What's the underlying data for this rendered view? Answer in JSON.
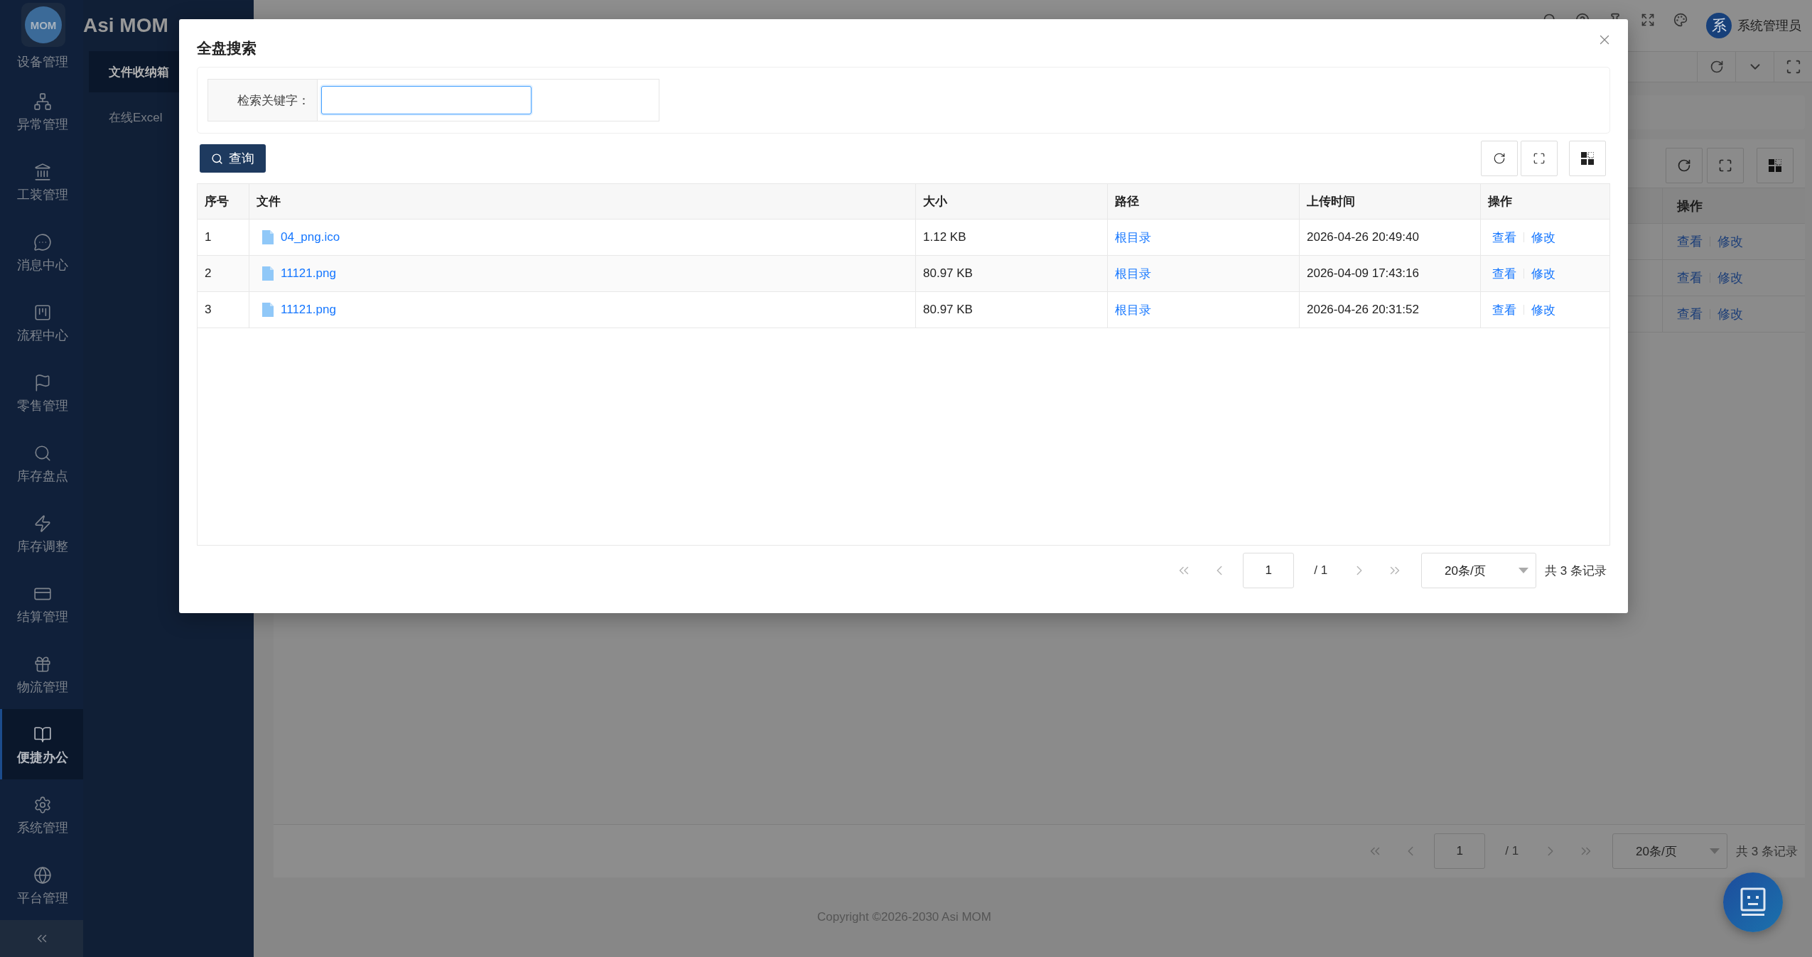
{
  "app": {
    "logo": "MOM",
    "name": "Asi MOM"
  },
  "rail": {
    "items": [
      {
        "label": "设备管理",
        "selected": false
      },
      {
        "label": "异常管理",
        "selected": false
      },
      {
        "label": "工装管理",
        "selected": false
      },
      {
        "label": "消息中心",
        "selected": false
      },
      {
        "label": "流程中心",
        "selected": false
      },
      {
        "label": "零售管理",
        "selected": false
      },
      {
        "label": "库存盘点",
        "selected": false
      },
      {
        "label": "库存调整",
        "selected": false
      },
      {
        "label": "结算管理",
        "selected": false
      },
      {
        "label": "物流管理",
        "selected": false
      },
      {
        "label": "便捷办公",
        "selected": true
      },
      {
        "label": "系统管理",
        "selected": false
      },
      {
        "label": "平台管理",
        "selected": false
      }
    ]
  },
  "submenu": [
    {
      "label": "文件收纳箱",
      "selected": true
    },
    {
      "label": "在线Excel",
      "selected": false
    }
  ],
  "header": {
    "avatar": "系",
    "user": "系统管理员"
  },
  "page": {
    "table": {
      "columns": [
        "操作"
      ],
      "rows": [
        {
          "actions": [
            "查看",
            "修改"
          ]
        },
        {
          "actions": [
            "查看",
            "修改"
          ]
        },
        {
          "actions": [
            "查看",
            "修改"
          ]
        }
      ]
    },
    "pagination": {
      "page": "1",
      "pages": "/ 1",
      "page_size": "20条/页",
      "summary": "共 3 条记录"
    }
  },
  "footer": {
    "copyright": "Copyright ©2026-2030 Asi MOM"
  },
  "dialog": {
    "title": "全盘搜索",
    "search": {
      "label": "检索关键字：",
      "focused": true
    },
    "query_button": "查询",
    "table": {
      "columns": [
        "序号",
        "文件",
        "大小",
        "路径",
        "上传时间",
        "操作"
      ],
      "rows": [
        {
          "index": "1",
          "file": "04_png.ico",
          "size": "1.12 KB",
          "path": "根目录",
          "uploaded": "2026-04-26 20:49:40",
          "actions": [
            "查看",
            "修改"
          ]
        },
        {
          "index": "2",
          "file": "11121.png",
          "size": "80.97 KB",
          "path": "根目录",
          "uploaded": "2026-04-09 17:43:16",
          "actions": [
            "查看",
            "修改"
          ]
        },
        {
          "index": "3",
          "file": "11121.png",
          "size": "80.97 KB",
          "path": "根目录",
          "uploaded": "2026-04-26 20:31:52",
          "actions": [
            "查看",
            "修改"
          ]
        }
      ]
    },
    "pagination": {
      "page": "1",
      "pages": "/ 1",
      "page_size": "20条/页",
      "summary": "共 3 条记录"
    }
  }
}
